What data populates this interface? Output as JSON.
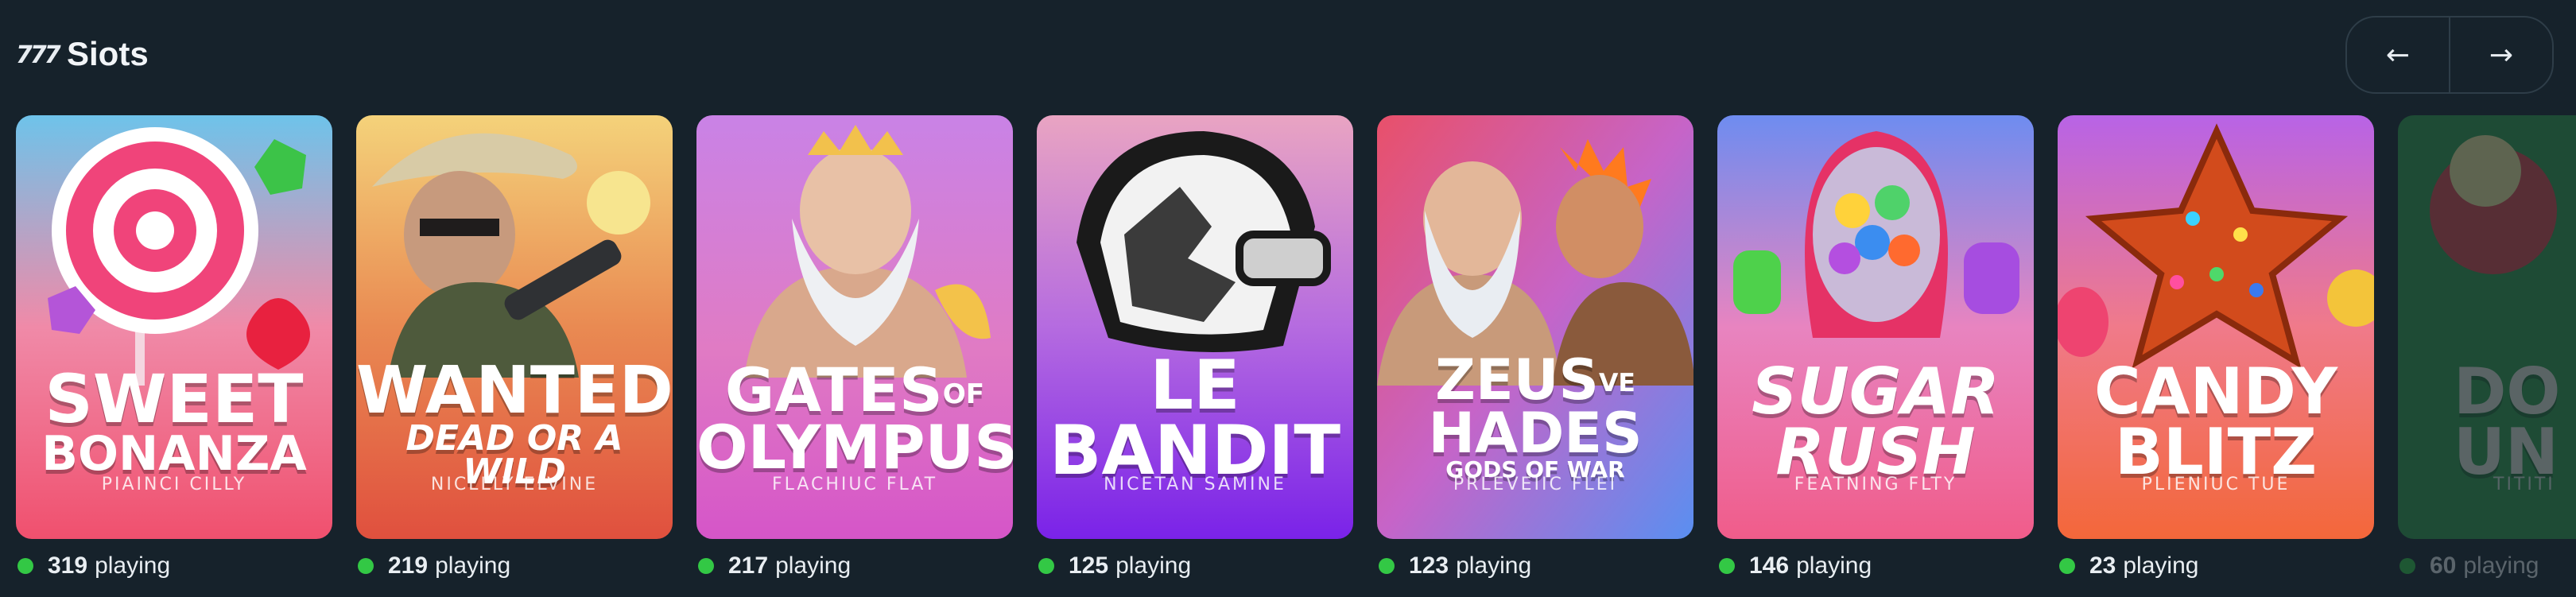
{
  "header": {
    "icon_text": "777",
    "title": "Siots",
    "prev_label": "←",
    "next_label": "→"
  },
  "games": [
    {
      "title_lines": [
        "SWEET",
        "BONANZA"
      ],
      "subtitle": "PIAINCI CILLY",
      "count": "319",
      "suffix": "playing"
    },
    {
      "title_lines": [
        "WANTED",
        "DEAD OR A WILD"
      ],
      "subtitle": "NICLLLY ELVINE",
      "count": "219",
      "suffix": "playing"
    },
    {
      "title_lines": [
        "GATES",
        "OF",
        "OLYMPUS"
      ],
      "subtitle": "FLACHIUC FLAT",
      "count": "217",
      "suffix": "playing"
    },
    {
      "title_lines": [
        "LE",
        "BANDIT"
      ],
      "subtitle": "NICETAN SAMINE",
      "count": "125",
      "suffix": "playing"
    },
    {
      "title_lines": [
        "ZEUS",
        "VE",
        "HADES",
        "GODS OF WAR"
      ],
      "subtitle": "PRLEVEIIC FLEI",
      "count": "123",
      "suffix": "playing"
    },
    {
      "title_lines": [
        "SUGAR",
        "RUSH"
      ],
      "subtitle": "FEATNING FLTY",
      "count": "146",
      "suffix": "playing"
    },
    {
      "title_lines": [
        "CANDY",
        "BLITZ"
      ],
      "subtitle": "PLIENIUC TUE",
      "count": "23",
      "suffix": "playing"
    },
    {
      "title_lines": [
        "DO",
        "UN"
      ],
      "subtitle": "TITITI",
      "count": "60",
      "suffix": "playing"
    }
  ],
  "colors": {
    "background": "#16222b",
    "playing_dot": "#33c845"
  }
}
